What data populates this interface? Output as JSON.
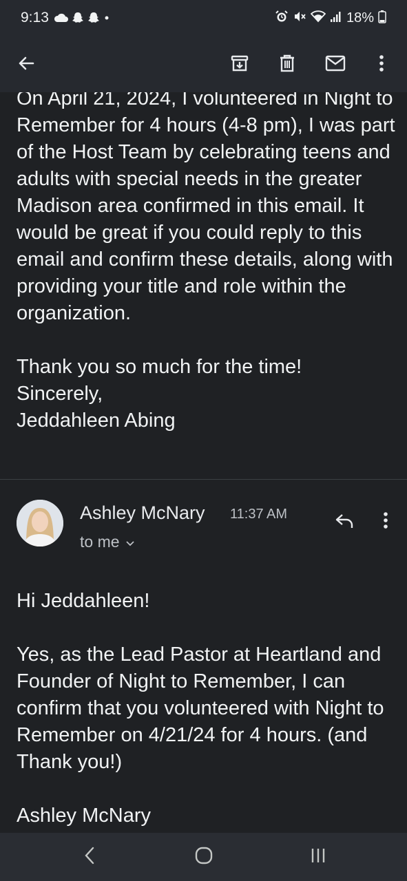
{
  "status_bar": {
    "time": "9:13",
    "battery": "18%",
    "icons": [
      "cloud-icon",
      "snapchat-icon",
      "snapchat-icon",
      "dot-icon",
      "alarm-icon",
      "mute-icon",
      "wifi-icon",
      "signal-icon",
      "battery-icon"
    ]
  },
  "app_bar": {
    "icons": [
      "back-arrow-icon",
      "archive-icon",
      "delete-icon",
      "mark-unread-icon",
      "more-vert-icon"
    ]
  },
  "previous_message": {
    "text": "On April 21, 2024, I volunteered in Night to Remember for 4 hours (4-8 pm), I was part of the Host Team by celebrating teens and adults with special needs in the greater Madison area confirmed in this email. It would be great if you could reply to this email and confirm these details, along with providing your title and role within the organization.\n\nThank you so much for the time!\nSincerely,\nJeddahleen Abing"
  },
  "message": {
    "sender": "Ashley McNary",
    "time": "11:37 AM",
    "recipient": "to me",
    "body": "Hi Jeddahleen!\n\nYes, as the Lead Pastor at Heartland and Founder of Night to Remember, I can confirm that you volunteered with Night to Remember on 4/21/24 for 4 hours. (and Thank you!)\n\nAshley McNary"
  },
  "nav_bar": {
    "icons": [
      "back-nav-icon",
      "home-nav-icon",
      "recents-nav-icon"
    ]
  },
  "colors": {
    "background": "#1f2124",
    "bar": "#26292f",
    "text": "#f1f3f4",
    "secondary_text": "#bdc1c6"
  }
}
